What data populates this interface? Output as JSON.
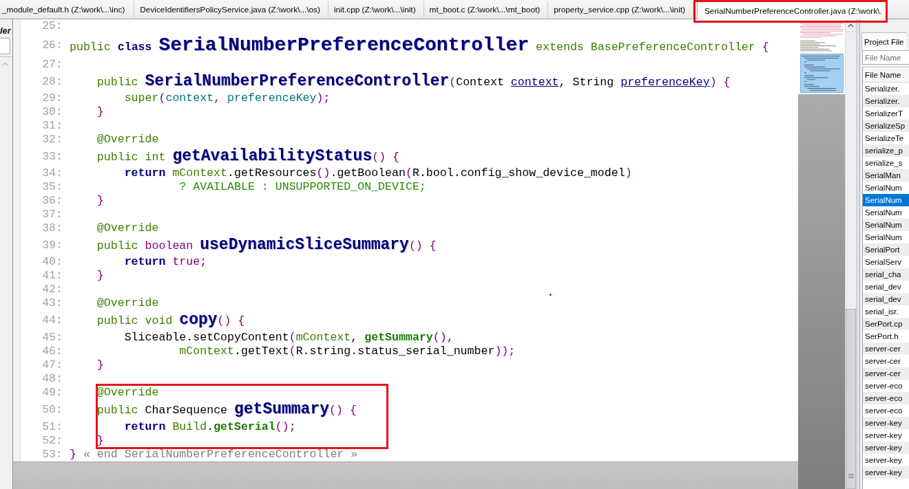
{
  "tabs": [
    {
      "label": "_module_default.h (Z:\\work\\...\\inc)",
      "selected": false,
      "framed": false
    },
    {
      "label": "DeviceIdentifiersPolicyService.java (Z:\\work\\...\\os)",
      "selected": false,
      "framed": false
    },
    {
      "label": "init.cpp (Z:\\work\\...\\init)",
      "selected": false,
      "framed": false
    },
    {
      "label": "mt_boot.c (Z:\\work\\...\\mt_boot)",
      "selected": false,
      "framed": false
    },
    {
      "label": "property_service.cpp (Z:\\work\\...\\init)",
      "selected": false,
      "framed": false
    },
    {
      "label": "SerialNumberPreferenceController.java (Z:\\work\\.",
      "selected": true,
      "framed": true
    }
  ],
  "side_panel": {
    "title": "ler"
  },
  "editor": {
    "lines": [
      {
        "number": "25:",
        "framed": false
      },
      {
        "number": "26:",
        "framed": false,
        "tokens": [
          {
            "text": "public ",
            "kind": "modifier"
          },
          {
            "text": "class ",
            "kind": "keyword"
          },
          {
            "text": "SerialNumberPreferenceController",
            "kind": "class-name"
          },
          {
            "text": " extends BasePreferenceController ",
            "kind": "modifier"
          },
          {
            "text": "{",
            "kind": "punct"
          }
        ],
        "children": [
          {
            "number": "27:",
            "framed": false
          },
          {
            "number": "28:",
            "framed": false,
            "tokens": [
              {
                "text": "public ",
                "kind": "modifier"
              },
              {
                "text": "SerialNumberPreferenceController",
                "kind": "method-name"
              },
              {
                "text": "(",
                "kind": "punct"
              },
              {
                "text": "Context ",
                "kind": "plain"
              },
              {
                "text": "context",
                "kind": "param-decl"
              },
              {
                "text": ", String ",
                "kind": "plain"
              },
              {
                "text": "preferenceKey",
                "kind": "param-decl"
              },
              {
                "text": ") {",
                "kind": "punct"
              }
            ],
            "children": [
              {
                "number": "29:",
                "framed": false,
                "tokens": [
                  {
                    "text": "super",
                    "kind": "modifier"
                  },
                  {
                    "text": "(",
                    "kind": "punct"
                  },
                  {
                    "text": "context",
                    "kind": "param"
                  },
                  {
                    "text": ", ",
                    "kind": "punct"
                  },
                  {
                    "text": "preferenceKey",
                    "kind": "param"
                  },
                  {
                    "text": ");",
                    "kind": "punct"
                  }
                ]
              }
            ]
          },
          {
            "number": "30:",
            "framed": false,
            "tokens": [
              {
                "text": "}",
                "kind": "punct"
              }
            ]
          },
          {
            "number": "31:",
            "framed": false
          },
          {
            "number": "32:",
            "framed": false,
            "tokens": [
              {
                "text": "@Override",
                "kind": "modifier"
              }
            ]
          },
          {
            "number": "33:",
            "framed": false,
            "tokens": [
              {
                "text": "public int ",
                "kind": "modifier"
              },
              {
                "text": "getAvailabilityStatus",
                "kind": "method-name"
              },
              {
                "text": "() {",
                "kind": "punct"
              }
            ],
            "children": [
              {
                "number": "34:",
                "framed": false,
                "tokens": [
                  {
                    "text": "return ",
                    "kind": "keyword"
                  },
                  {
                    "text": "mContext",
                    "kind": "field"
                  },
                  {
                    "text": ".getResources",
                    "kind": "plain"
                  },
                  {
                    "text": "()",
                    "kind": "punct"
                  },
                  {
                    "text": ".getBoolean",
                    "kind": "plain"
                  },
                  {
                    "text": "(",
                    "kind": "punct"
                  },
                  {
                    "text": "R.bool.config_show_device_model",
                    "kind": "plain"
                  },
                  {
                    "text": ")",
                    "kind": "punct"
                  }
                ],
                "children": [
                  {
                    "number": "35:",
                    "kind": "continuation",
                    "framed": false,
                    "tokens": [
                      {
                        "text": "? AVAILABLE : UNSUPPORTED_ON_DEVICE;",
                        "kind": "constant"
                      }
                    ]
                  }
                ]
              }
            ]
          },
          {
            "number": "36:",
            "framed": false,
            "tokens": [
              {
                "text": "}",
                "kind": "punct"
              }
            ]
          },
          {
            "number": "37:",
            "framed": false
          },
          {
            "number": "38:",
            "framed": false,
            "tokens": [
              {
                "text": "@Override",
                "kind": "modifier"
              }
            ]
          },
          {
            "number": "39:",
            "framed": false,
            "tokens": [
              {
                "text": "public ",
                "kind": "modifier"
              },
              {
                "text": "boolean ",
                "kind": "primitive"
              },
              {
                "text": "useDynamicSliceSummary",
                "kind": "method-name"
              },
              {
                "text": "() {",
                "kind": "punct"
              }
            ],
            "children": [
              {
                "number": "40:",
                "framed": false,
                "tokens": [
                  {
                    "text": "return ",
                    "kind": "keyword"
                  },
                  {
                    "text": "true",
                    "kind": "primitive"
                  },
                  {
                    "text": ";",
                    "kind": "punct"
                  }
                ]
              }
            ]
          },
          {
            "number": "41:",
            "framed": false,
            "tokens": [
              {
                "text": "}",
                "kind": "punct"
              }
            ]
          },
          {
            "number": "42:",
            "framed": false
          },
          {
            "number": "43:",
            "framed": false,
            "tokens": [
              {
                "text": "@Override",
                "kind": "modifier"
              }
            ]
          },
          {
            "number": "44:",
            "framed": false,
            "tokens": [
              {
                "text": "public void ",
                "kind": "modifier"
              },
              {
                "text": "copy",
                "kind": "method-name"
              },
              {
                "text": "() {",
                "kind": "punct"
              }
            ],
            "children": [
              {
                "number": "45:",
                "framed": false,
                "tokens": [
                  {
                    "text": "Sliceable.setCopyContent",
                    "kind": "plain"
                  },
                  {
                    "text": "(",
                    "kind": "punct"
                  },
                  {
                    "text": "mContext",
                    "kind": "field"
                  },
                  {
                    "text": ", ",
                    "kind": "plain"
                  },
                  {
                    "text": "getSummary",
                    "kind": "call"
                  },
                  {
                    "text": "(),",
                    "kind": "punct"
                  }
                ],
                "children": [
                  {
                    "number": "46:",
                    "kind": "continuation",
                    "framed": false,
                    "tokens": [
                      {
                        "text": "mContext",
                        "kind": "field"
                      },
                      {
                        "text": ".getText",
                        "kind": "plain"
                      },
                      {
                        "text": "(",
                        "kind": "punct"
                      },
                      {
                        "text": "R.string.status_serial_number",
                        "kind": "plain"
                      },
                      {
                        "text": "));",
                        "kind": "punct"
                      }
                    ]
                  }
                ]
              }
            ]
          },
          {
            "number": "47:",
            "framed": false,
            "tokens": [
              {
                "text": "}",
                "kind": "punct"
              }
            ]
          },
          {
            "number": "48:",
            "framed": false
          },
          {
            "number": "49:",
            "framed": true,
            "tokens": [
              {
                "text": "@Override",
                "kind": "modifier"
              }
            ]
          },
          {
            "number": "50:",
            "framed": true,
            "tokens": [
              {
                "text": "public ",
                "kind": "modifier"
              },
              {
                "text": "CharSequence ",
                "kind": "plain"
              },
              {
                "text": "getSummary",
                "kind": "method-name"
              },
              {
                "text": "() {",
                "kind": "punct"
              }
            ],
            "children": [
              {
                "number": "51:",
                "framed": true,
                "tokens": [
                  {
                    "text": "return ",
                    "kind": "keyword"
                  },
                  {
                    "text": "Build",
                    "kind": "field"
                  },
                  {
                    "text": ".",
                    "kind": "plain"
                  },
                  {
                    "text": "getSerial",
                    "kind": "call"
                  },
                  {
                    "text": "();",
                    "kind": "punct"
                  }
                ]
              }
            ]
          },
          {
            "number": "52:",
            "framed": true,
            "tokens": [
              {
                "text": "}",
                "kind": "punct"
              }
            ]
          }
        ]
      },
      {
        "number": "53:",
        "framed": false,
        "tokens": [
          {
            "text": "}",
            "kind": "punct"
          },
          {
            "text": " « end SerialNumberPreferenceController »",
            "kind": "end-marker"
          }
        ]
      }
    ]
  },
  "file_panel": {
    "tab": "Project File",
    "search": {
      "placeholder": "File Name"
    },
    "column": "File Name",
    "files": [
      {
        "name": "Serializer.",
        "selected": false
      },
      {
        "name": "Serializer.",
        "selected": false
      },
      {
        "name": "SerializerT",
        "selected": false
      },
      {
        "name": "SerializeSp",
        "selected": false
      },
      {
        "name": "SerializeTe",
        "selected": false
      },
      {
        "name": "serialize_p",
        "selected": false
      },
      {
        "name": "serialize_s",
        "selected": false
      },
      {
        "name": "SerialMan",
        "selected": false
      },
      {
        "name": "SerialNum",
        "selected": false
      },
      {
        "name": "SerialNum",
        "selected": true
      },
      {
        "name": "SerialNum",
        "selected": false
      },
      {
        "name": "SerialNum",
        "selected": false
      },
      {
        "name": "SerialNum",
        "selected": false
      },
      {
        "name": "SerialPort",
        "selected": false
      },
      {
        "name": "SerialServ",
        "selected": false
      },
      {
        "name": "serial_cha",
        "selected": false
      },
      {
        "name": "serial_dev",
        "selected": false
      },
      {
        "name": "serial_dev",
        "selected": false
      },
      {
        "name": "serial_isr.",
        "selected": false
      },
      {
        "name": "SerPort.cp",
        "selected": false
      },
      {
        "name": "SerPort.h",
        "selected": false
      },
      {
        "name": "server-cer",
        "selected": false
      },
      {
        "name": "server-cer",
        "selected": false
      },
      {
        "name": "server-cer",
        "selected": false
      },
      {
        "name": "server-eco",
        "selected": false
      },
      {
        "name": "server-eco",
        "selected": false
      },
      {
        "name": "server-eco",
        "selected": false
      },
      {
        "name": "server-key",
        "selected": false
      },
      {
        "name": "server-key",
        "selected": false
      },
      {
        "name": "server-key",
        "selected": false
      },
      {
        "name": "server-key",
        "selected": false
      },
      {
        "name": "server-key",
        "selected": false
      }
    ]
  }
}
